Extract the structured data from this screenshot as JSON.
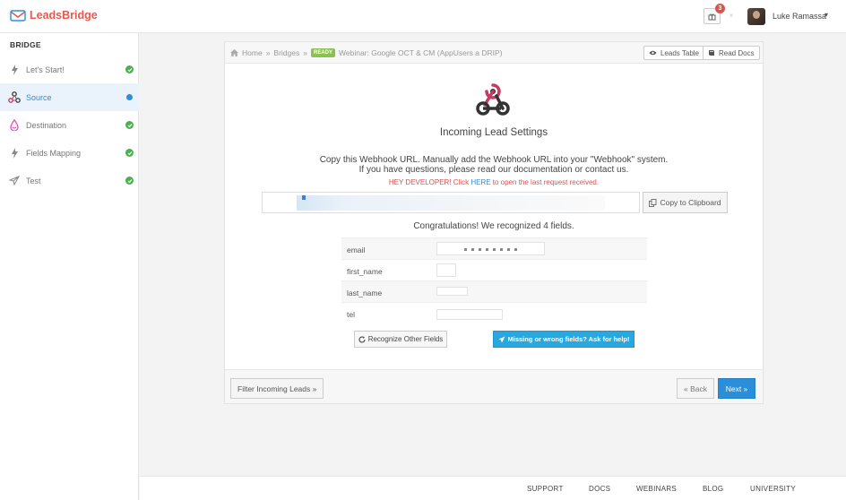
{
  "brand": {
    "name": "LeadsBridge",
    "color": "#e8594f"
  },
  "topbar": {
    "notification_count": "3",
    "user_name": "Luke Ramassa",
    "user_caret": "▾"
  },
  "sidebar": {
    "title": "BRIDGE",
    "items": [
      {
        "label": "Let's Start!",
        "icon": "bolt-icon",
        "status": "done"
      },
      {
        "label": "Source",
        "icon": "webhook-icon",
        "status": "active"
      },
      {
        "label": "Destination",
        "icon": "drip-icon",
        "status": "done"
      },
      {
        "label": "Fields Mapping",
        "icon": "bolt-icon",
        "status": "done"
      },
      {
        "label": "Test",
        "icon": "paper-plane-icon",
        "status": "done"
      }
    ]
  },
  "breadcrumb": {
    "home": "Home",
    "sep": "»",
    "bridges": "Bridges",
    "badge": "READY",
    "current": "Webinar: Google OCT & CM (AppUsers a DRIP)"
  },
  "header_buttons": {
    "leads_table": "Leads Table",
    "read_docs": "Read Docs"
  },
  "main": {
    "title": "Incoming Lead Settings",
    "desc_line1": "Copy this Webhook URL. Manually add the Webhook URL into your \"Webhook\" system.",
    "desc_line2": "If you have questions, please read our documentation or contact us.",
    "dev_before": "HEY DEVELOPER! Click ",
    "dev_link": "HERE",
    "dev_after": " to open the last request received.",
    "copy_button": "Copy to Clipboard",
    "congrats": "Congratulations! We recognized 4 fields.",
    "fields": [
      {
        "name": "email"
      },
      {
        "name": "first_name"
      },
      {
        "name": "last_name"
      },
      {
        "name": "tel"
      }
    ],
    "recognize_button": "Recognize Other Fields",
    "help_button": "Missing or wrong fields? Ask for help!"
  },
  "footer_nav": {
    "filter_button": "Filter Incoming Leads »",
    "back_button": "« Back",
    "next_button": "Next »"
  },
  "footer_links": [
    "SUPPORT",
    "DOCS",
    "WEBINARS",
    "BLOG",
    "UNIVERSITY"
  ],
  "colors": {
    "primary": "#2a8fd8",
    "success": "#4caf50",
    "danger": "#d9534f",
    "ready": "#8cc152"
  }
}
